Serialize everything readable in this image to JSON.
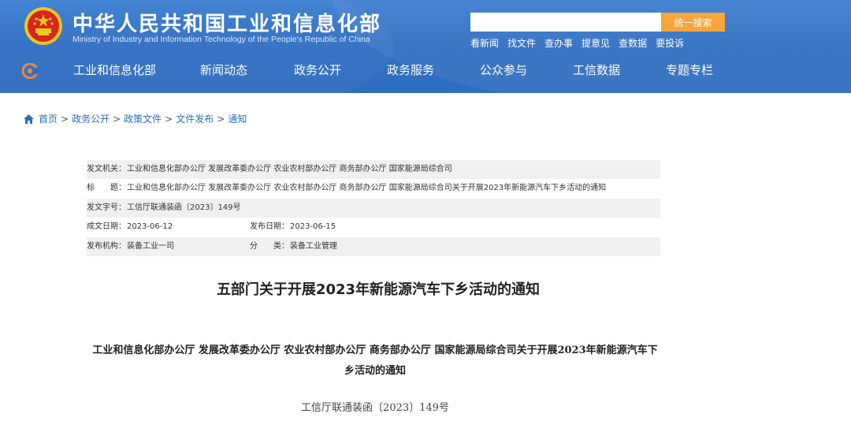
{
  "header": {
    "title": "中华人民共和国工业和信息化部",
    "subtitle": "Ministry of Industry and Information Technology of the People's Republic of China",
    "search": {
      "placeholder": "",
      "button_label": "统一搜索"
    },
    "quick_links": [
      "看新闻",
      "找文件",
      "查办事",
      "提意见",
      "查数据",
      "要投诉"
    ]
  },
  "nav": {
    "items": [
      "工业和信息化部",
      "新闻动态",
      "政务公开",
      "政务服务",
      "公众参与",
      "工信数据",
      "专题专栏"
    ]
  },
  "breadcrumb": [
    "首页",
    "政务公开",
    "政策文件",
    "文件发布",
    "通知"
  ],
  "meta": {
    "issuer_label": "发文机关：",
    "issuer": "工业和信息化部办公厅 发展改革委办公厅 农业农村部办公厅 商务部办公厅 国家能源局综合司",
    "title_label": "标　　题：",
    "title": "工业和信息化部办公厅 发展改革委办公厅 农业农村部办公厅 商务部办公厅 国家能源局综合司关于开展2023年新能源汽车下乡活动的通知",
    "doc_no_label": "发文字号：",
    "doc_no": "工信厅联通装函〔2023〕149号",
    "created_label": "成文日期：",
    "created": "2023-06-12",
    "published_label": "发布日期：",
    "published": "2023-06-15",
    "org_label": "发布机构：",
    "org": "装备工业一司",
    "category_label": "分　　类：",
    "category": "装备工业管理"
  },
  "article": {
    "title": "五部门关于开展2023年新能源汽车下乡活动的通知",
    "heading_line1": "工业和信息化部办公厅 发展改革委办公厅 农业农村部办公厅 商务部办公厅 国家能源局综合司关于开展2023年新能源汽车下",
    "heading_line2": "乡活动的通知",
    "doc_no": "工信厅联通装函〔2023〕149号"
  },
  "colors": {
    "header_blue": "#2f6dbf",
    "search_button": "#f4a63a",
    "emblem_red": "#d7261e",
    "emblem_gold": "#f3c623"
  },
  "icons": {
    "emblem": "national-emblem-icon",
    "nav_logo": "miit-logo-icon",
    "home": "home-icon"
  }
}
